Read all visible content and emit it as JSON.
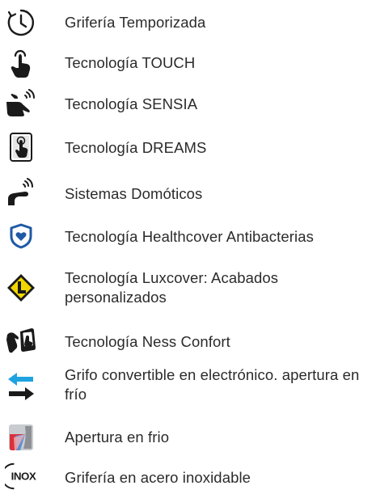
{
  "items": [
    {
      "icon": "timer-clock-icon",
      "label": "Grifería Temporizada"
    },
    {
      "icon": "touch-hand-icon",
      "label": "Tecnología TOUCH"
    },
    {
      "icon": "sensor-hand-icon",
      "label": "Tecnología SENSIA"
    },
    {
      "icon": "dreams-touch-panel-icon",
      "label": "Tecnología DREAMS"
    },
    {
      "icon": "domotic-system-icon",
      "label": "Sistemas Domóticos"
    },
    {
      "icon": "healthcover-shield-icon",
      "label": "Tecnología Healthcover Antibacterias"
    },
    {
      "icon": "luxcover-diamond-icon",
      "label": "Tecnología Luxcover: Acabados personalizados"
    },
    {
      "icon": "ness-confort-hands-icon",
      "label": "Tecnología Ness Confort"
    },
    {
      "icon": "convertible-arrows-icon",
      "label": "Grifo convertible en electrónico. apertura en frío"
    },
    {
      "icon": "cold-opening-icon",
      "label": "Apertura en frio"
    },
    {
      "icon": "inox-steel-icon",
      "icon_text": "INOX",
      "label": "Grifería en acero inoxidable"
    }
  ],
  "colors": {
    "text": "#2b2b2b",
    "icon_dark": "#1a1a1a",
    "shield_blue": "#1f5aa6",
    "diamond_yellow": "#f2d600",
    "arrow_blue": "#1fa3e0",
    "cold_red": "#d9313b",
    "cold_blue": "#5a8fd6",
    "cold_grey": "#8c9095"
  }
}
